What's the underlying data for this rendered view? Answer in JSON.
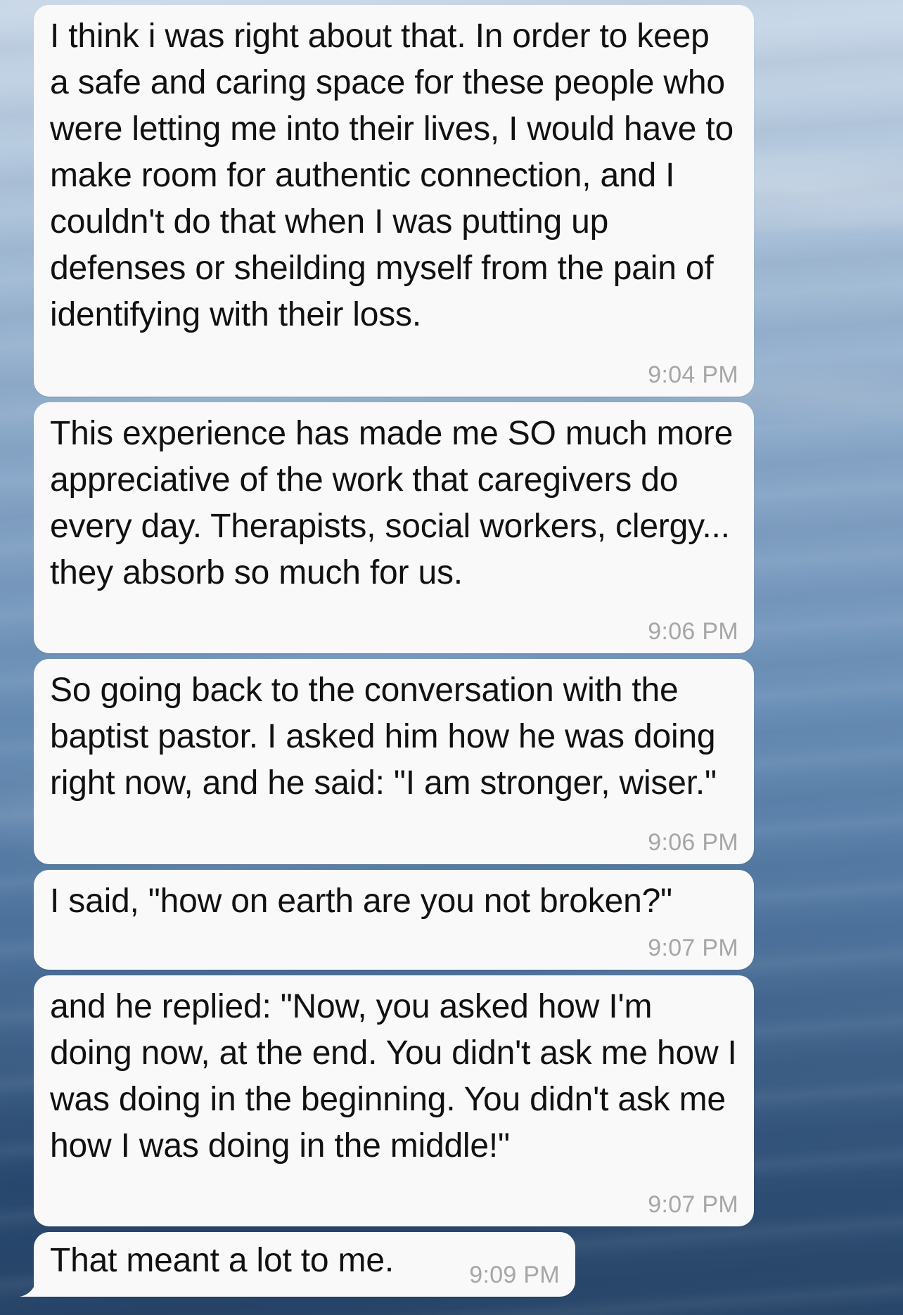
{
  "conversation": {
    "messages": [
      {
        "text": "I think i was right about that. In order to keep a safe and caring space for these people who were letting me into their lives, I would have to make room for authentic connection, and I couldn't do that when I was putting up defenses or sheilding myself from the pain of identifying with their loss.",
        "time": "9:04 PM"
      },
      {
        "text": "This experience has made me SO much more appreciative of the work that caregivers do every day. Therapists, social workers, clergy... they absorb so much for us.",
        "time": "9:06 PM"
      },
      {
        "text": "So going back to the conversation with the baptist pastor. I asked him how he was doing right now, and he said: \"I am stronger, wiser.\"",
        "time": "9:06 PM"
      },
      {
        "text": "I said, \"how on earth are you not broken?\"",
        "time": "9:07 PM"
      },
      {
        "text": "and he replied: \"Now, you asked how I'm doing now, at the end. You didn't ask me how I was doing in the beginning. You didn't ask me how I was doing in the middle!\"",
        "time": "9:07 PM"
      },
      {
        "text": "That meant a lot to me.",
        "time": "9:09 PM"
      }
    ]
  },
  "colors": {
    "bubble_background": "#f9f9f9",
    "message_text": "#111111",
    "timestamp_text": "#a6a6a6"
  }
}
